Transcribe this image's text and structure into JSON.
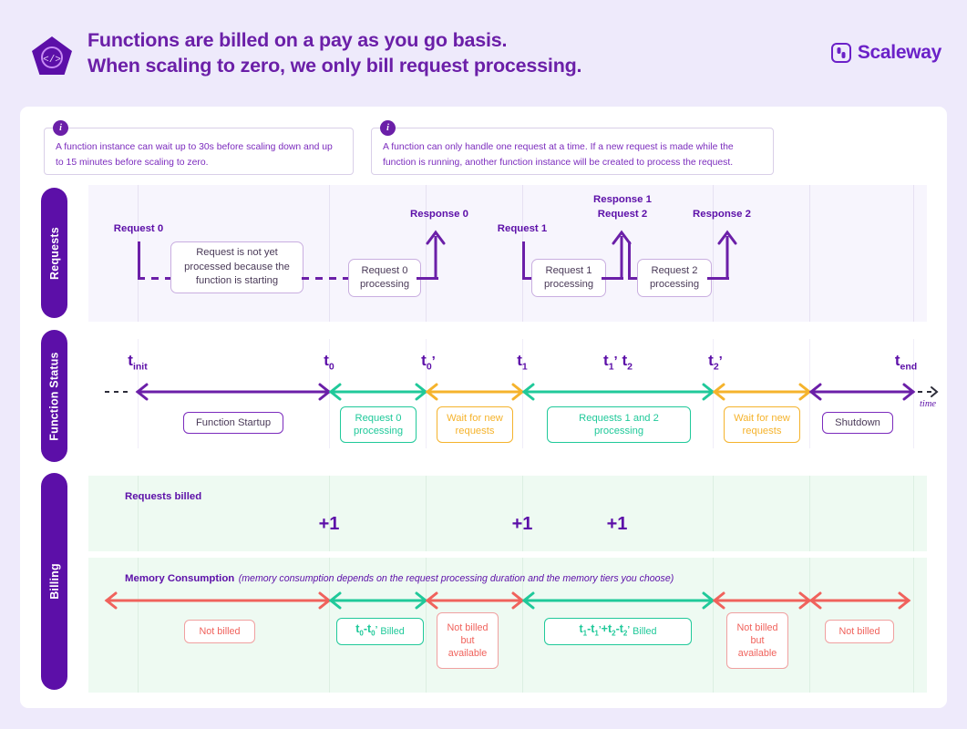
{
  "header": {
    "title_line1": "Functions are billed on a pay as you go basis.",
    "title_line2": "When scaling to zero, we only bill request processing.",
    "brand_name": "Scaleway",
    "logo_icon": "code-pentagon-icon",
    "brand_icon": "scaleway-mark-icon"
  },
  "info_boxes": [
    {
      "icon": "info-icon",
      "text": "A function instance can wait up to 30s before scaling down and up to 15 minutes before scaling to zero."
    },
    {
      "icon": "info-icon",
      "text": "A function can only handle one request at a time. If a new request is made while the function is running, another function instance will be created to process the request."
    }
  ],
  "bands": [
    {
      "label": "Requests"
    },
    {
      "label": "Function Status"
    },
    {
      "label": "Billing"
    }
  ],
  "requests_row": {
    "markers": [
      {
        "label": "Request 0"
      },
      {
        "label": "Response 0"
      },
      {
        "label": "Request 1"
      },
      {
        "label": "Response 1"
      },
      {
        "label": "Request 2"
      },
      {
        "label": "Response 2"
      }
    ],
    "boxes": [
      {
        "text": "Request is not yet processed because the function is starting"
      },
      {
        "text": "Request 0 processing"
      },
      {
        "text": "Request 1 processing"
      },
      {
        "text": "Request 2 processing"
      }
    ]
  },
  "status_row": {
    "ticks": [
      {
        "base": "t",
        "sub": "init",
        "prime": ""
      },
      {
        "base": "t",
        "sub": "0",
        "prime": ""
      },
      {
        "base": "t",
        "sub": "0",
        "prime": "’"
      },
      {
        "base": "t",
        "sub": "1",
        "prime": ""
      },
      {
        "base": "t",
        "sub": "1",
        "prime": "’"
      },
      {
        "base": "t",
        "sub": "2",
        "prime": ""
      },
      {
        "base": "t",
        "sub": "2",
        "prime": "’"
      },
      {
        "base": "t",
        "sub": "end",
        "prime": ""
      }
    ],
    "time_axis_label": "time",
    "segments": [
      {
        "label": "Function Startup",
        "color": "#6B1FA8"
      },
      {
        "label": "Request 0 processing",
        "color": "#20C99A"
      },
      {
        "label": "Wait for new requests",
        "color": "#F5B32C"
      },
      {
        "label": "Requests 1 and 2 processing",
        "color": "#20C99A"
      },
      {
        "label": "Wait for new requests",
        "color": "#F5B32C"
      },
      {
        "label": "Shutdown",
        "color": "#6B1FA8"
      }
    ]
  },
  "billing_row": {
    "requests_billed_label": "Requests billed",
    "request_counts": [
      "+1",
      "+1",
      "+1"
    ],
    "memory_label": "Memory Consumption",
    "memory_note": "(memory consumption depends on the request processing duration and the memory tiers you choose)",
    "segments": [
      {
        "label": "Not billed",
        "color": "#F0625C",
        "billed": false
      },
      {
        "label": "t 0 - t 0 ’ Billed",
        "color": "#20C99A",
        "billed": true
      },
      {
        "label": "Not billed but available",
        "color": "#F0625C",
        "billed": false
      },
      {
        "label": "t 1 - t 1 ’ + t 2 - t 2 ’ Billed",
        "color": "#20C99A",
        "billed": true
      },
      {
        "label": "Not billed but available",
        "color": "#F0625C",
        "billed": false
      },
      {
        "label": "Not billed",
        "color": "#F0625C",
        "billed": false
      }
    ]
  },
  "colors": {
    "purple": "#5C0FA8",
    "purple_light": "#7B2BBD",
    "teal": "#20C99A",
    "amber": "#F5B32C",
    "red": "#F0625C",
    "page_bg": "#eeeaFB",
    "card_bg": "#ffffff",
    "requests_panel_bg": "#f7f5fd",
    "billing_panel_bg": "#eefaf2"
  }
}
